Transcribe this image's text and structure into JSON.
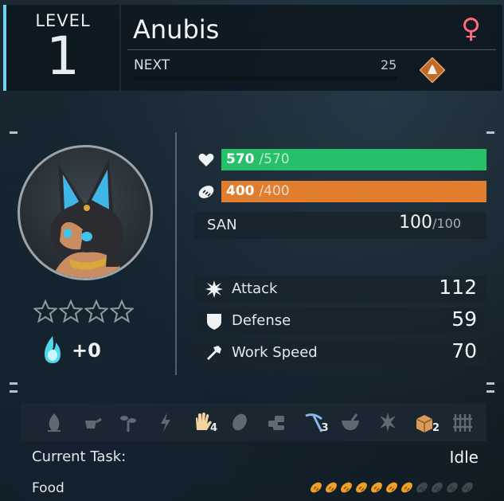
{
  "level": {
    "label": "LEVEL",
    "value": "1"
  },
  "pal": {
    "name": "Anubis",
    "gender_symbol": "♀"
  },
  "next": {
    "label": "NEXT",
    "value": "25",
    "progress": 0.0
  },
  "health": {
    "current": "570",
    "max": "/570",
    "fraction": 1.0
  },
  "stomach": {
    "current": "400",
    "max": "/400",
    "fraction": 1.0
  },
  "san": {
    "label": "SAN",
    "current": "100",
    "max": "/100"
  },
  "stats": [
    {
      "label": "Attack",
      "value": "112",
      "icon": "attack-icon"
    },
    {
      "label": "Defense",
      "value": "59",
      "icon": "defense-icon"
    },
    {
      "label": "Work Speed",
      "value": "70",
      "icon": "work-speed-icon"
    }
  ],
  "rank": {
    "stars_filled": 0,
    "stars_total": 4
  },
  "souls": {
    "value": "+0"
  },
  "work_suitability": [
    {
      "icon": "kindling-icon",
      "level": "",
      "active": false
    },
    {
      "icon": "watering-icon",
      "level": "",
      "active": false
    },
    {
      "icon": "planting-icon",
      "level": "",
      "active": false
    },
    {
      "icon": "electricity-icon",
      "level": "",
      "active": false
    },
    {
      "icon": "handiwork-icon",
      "level": "4",
      "active": true
    },
    {
      "icon": "gathering-icon",
      "level": "",
      "active": false
    },
    {
      "icon": "lumbering-icon",
      "level": "",
      "active": false
    },
    {
      "icon": "mining-icon",
      "level": "3",
      "active": true
    },
    {
      "icon": "medicine-icon",
      "level": "",
      "active": false
    },
    {
      "icon": "cooling-icon",
      "level": "",
      "active": false
    },
    {
      "icon": "transporting-icon",
      "level": "2",
      "active": true
    },
    {
      "icon": "farming-icon",
      "level": "",
      "active": false
    }
  ],
  "task": {
    "label": "Current Task:",
    "value": "Idle"
  },
  "food": {
    "label": "Food",
    "filled": 7,
    "total": 11
  },
  "colors": {
    "accent": "#6fd3f0",
    "hp": "#26c06b",
    "stomach": "#e07d2e",
    "gender": "#ff6b7e"
  }
}
